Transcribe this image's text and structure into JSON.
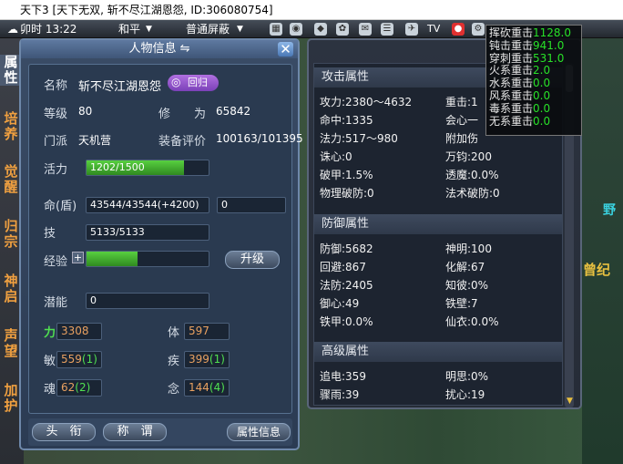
{
  "window": {
    "title": "天下3 [天下无双, 斩不尽江湖恩怨, ID:306080754]"
  },
  "topbar": {
    "time": "卯时 13:22",
    "mode": "和平",
    "filter": "普通屏蔽",
    "tv_label": "TV"
  },
  "side_tabs": [
    "属性",
    "培养",
    "觉醒",
    "归宗",
    "神启",
    "声望",
    "加护"
  ],
  "char_panel": {
    "title": "人物信息",
    "name_label": "名称",
    "name_value": "斩不尽江湖恩怨",
    "return_badge": "回归",
    "level_label": "等级",
    "level_value": "80",
    "cultivation_label": "修　　为",
    "cultivation_value": "65842",
    "sect_label": "门派",
    "sect_value": "天机营",
    "gear_label": "装备评价",
    "gear_value": "100163/101395",
    "vitality_label": "活力",
    "vitality_value": "1202/1500",
    "vitality_ratio": 0.8,
    "life_label": "命(盾)",
    "life_value": "43544/43544(+4200)",
    "life_extra": "0",
    "skill_label": "技",
    "skill_value": "5133/5133",
    "exp_label": "经验",
    "exp_plus": "+",
    "exp_ratio": 0.42,
    "upgrade_button": "升级",
    "potential_label": "潜能",
    "potential_value": "0",
    "stats": {
      "str_label": "力",
      "str_value": "3308",
      "con_label": "体",
      "con_value": "597",
      "agi_label": "敏",
      "agi_value": "559",
      "agi_bonus": "(1)",
      "spd_label": "疾",
      "spd_value": "399",
      "spd_bonus": "(1)",
      "soul_label": "魂",
      "soul_value": "62",
      "soul_bonus": "(2)",
      "mind_label": "念",
      "mind_value": "144",
      "mind_bonus": "(4)"
    },
    "bottom_buttons": {
      "rank": "头　衔",
      "title": "称　谓",
      "attr": "属性信息"
    }
  },
  "attr_panel": {
    "attack_header": "攻击属性",
    "attack_rows": [
      [
        "攻力:2380～4632",
        "重击:1"
      ],
      [
        "命中:1335",
        "会心一"
      ],
      [
        "法力:517～980",
        "附加伤"
      ],
      [
        "诛心:0",
        "万钧:200"
      ],
      [
        "破甲:1.5%",
        "透魔:0.0%"
      ],
      [
        "物理破防:0",
        "法术破防:0"
      ]
    ],
    "defense_header": "防御属性",
    "defense_rows": [
      [
        "防御:5682",
        "神明:100"
      ],
      [
        "回避:867",
        "化解:67"
      ],
      [
        "法防:2405",
        "知彼:0%"
      ],
      [
        "御心:49",
        "铁壁:7"
      ],
      [
        "铁甲:0.0%",
        "仙衣:0.0%"
      ]
    ],
    "advanced_header": "高级属性",
    "advanced_rows": [
      [
        "追电:359",
        "明思:0%"
      ],
      [
        "骤雨:39",
        "扰心:19"
      ]
    ]
  },
  "tooltip": {
    "rows": [
      {
        "name": "挥砍重击",
        "value": "1128.0"
      },
      {
        "name": "钝击重击",
        "value": "941.0"
      },
      {
        "name": "穿刺重击",
        "value": "531.0"
      },
      {
        "name": "火系重击",
        "value": "2.0"
      },
      {
        "name": "水系重击",
        "value": "0.0"
      },
      {
        "name": "风系重击",
        "value": "0.0"
      },
      {
        "name": "毒系重击",
        "value": "0.0"
      },
      {
        "name": "无系重击",
        "value": "0.0"
      }
    ]
  },
  "background": {
    "gold_text": "曾纪",
    "teal_text": "野"
  },
  "colors": {
    "vitality_bar": "#3fb02a",
    "exp_bar": "#3fb02a",
    "tooltip_value": "#28e028",
    "stat_bonus": "#50e050"
  }
}
